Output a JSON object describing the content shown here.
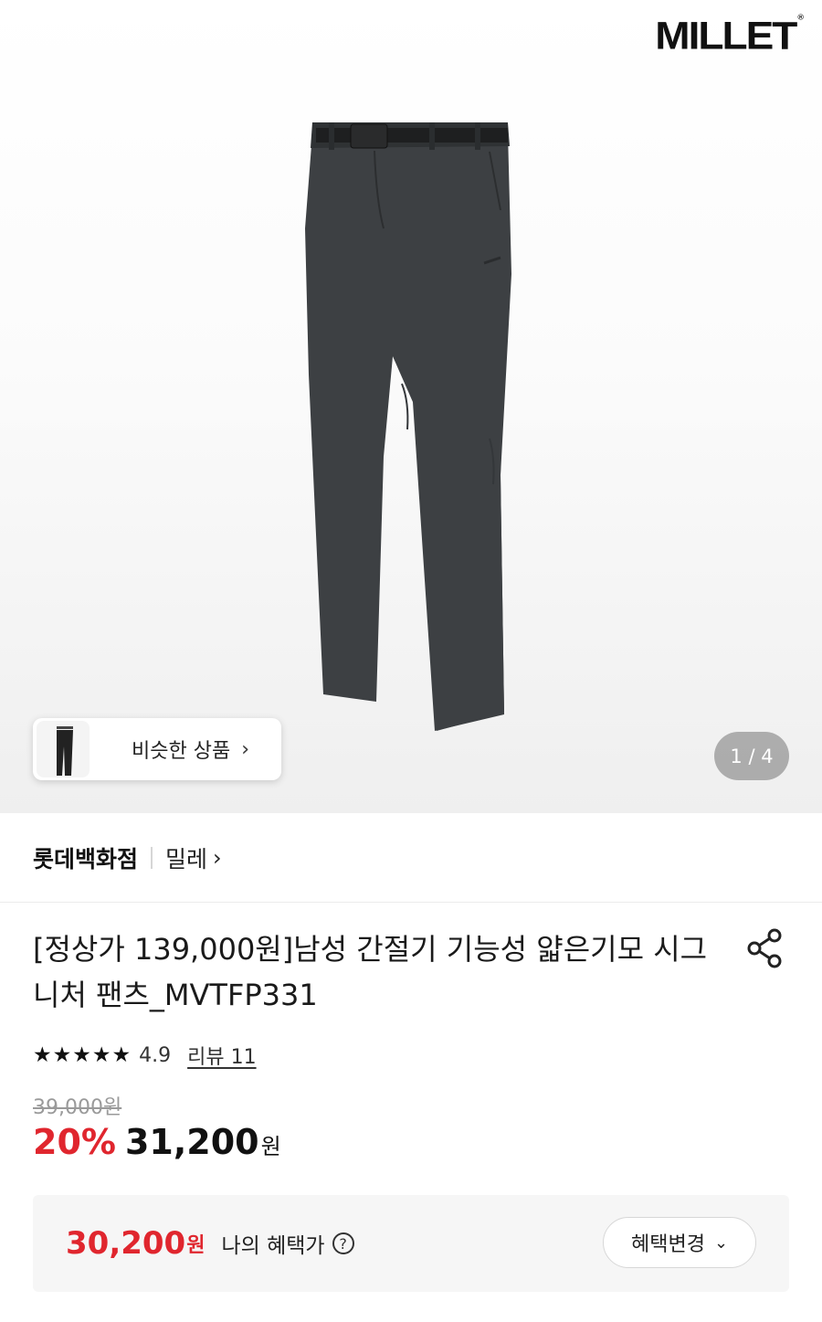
{
  "hero": {
    "brand_logo": "MILLET",
    "brand_logo_mark": "®",
    "similar_products_label": "비슷한 상품",
    "similar_chevron": "›",
    "pager": "1 / 4"
  },
  "store": {
    "store_name": "롯데백화점",
    "brand_name": "밀레",
    "chevron": "›"
  },
  "product": {
    "title": "[정상가 139,000원]남성 간절기 기능성 얇은기모 시그니처 팬츠_MVTFP331",
    "rating_stars": "★★★★★",
    "rating_value": "4.9",
    "review_link": "리뷰 11",
    "original_price": "39,000원",
    "discount": "20%",
    "sale_price": "31,200",
    "sale_currency": "원"
  },
  "benefit": {
    "price": "30,200",
    "currency": "원",
    "label": "나의 혜택가",
    "help": "?",
    "button_label": "혜택변경",
    "button_chevron": "⌄"
  },
  "colors": {
    "accent_red": "#e0262e",
    "pants": "#3d4043"
  },
  "icons": [
    "share-icon",
    "help-icon",
    "chevron-right-icon",
    "chevron-down-icon",
    "star-icon"
  ]
}
